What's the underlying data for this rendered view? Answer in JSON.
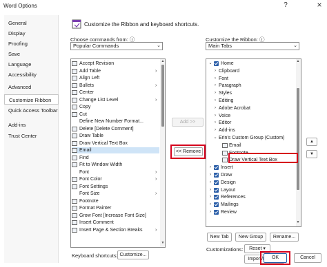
{
  "window": {
    "title": "Word Options",
    "help_glyph": "?",
    "close_glyph": "×"
  },
  "sidebar": {
    "items": [
      {
        "label": "General"
      },
      {
        "label": "Display"
      },
      {
        "label": "Proofing"
      },
      {
        "label": "Save"
      },
      {
        "label": "Language"
      },
      {
        "label": "Accessibility"
      },
      {
        "label": "Advanced"
      },
      {
        "label": "Customize Ribbon",
        "selected": true
      },
      {
        "label": "Quick Access Toolbar"
      },
      {
        "label": "Add-ins"
      },
      {
        "label": "Trust Center"
      }
    ]
  },
  "header": {
    "text": "Customize the Ribbon and keyboard shortcuts."
  },
  "left": {
    "label_pre": "",
    "label_key": "C",
    "label_post": "hoose commands from:",
    "info_glyph": "ⓘ",
    "dropdown_value": "Popular Commands",
    "commands": [
      {
        "label": "Accept Revision",
        "icon": "accept-revision-icon"
      },
      {
        "label": "Add Table",
        "icon": "table-icon",
        "submenu": true
      },
      {
        "label": "Align Left",
        "icon": "align-left-icon"
      },
      {
        "label": "Bullets",
        "icon": "bullets-icon",
        "submenu": true
      },
      {
        "label": "Center",
        "icon": "center-align-icon"
      },
      {
        "label": "Change List Level",
        "icon": "list-level-icon",
        "submenu": true
      },
      {
        "label": "Copy",
        "icon": "copy-icon"
      },
      {
        "label": "Cut",
        "icon": "cut-icon"
      },
      {
        "label": "Define New Number Format...",
        "icon": "blank-icon"
      },
      {
        "label": "Delete [Delete Comment]",
        "icon": "delete-comment-icon"
      },
      {
        "label": "Draw Table",
        "icon": "draw-table-icon"
      },
      {
        "label": "Draw Vertical Text Box",
        "icon": "vertical-text-box-icon"
      },
      {
        "label": "Email",
        "icon": "email-icon",
        "selected": true
      },
      {
        "label": "Find",
        "icon": "find-icon"
      },
      {
        "label": "Fit to Window Width",
        "icon": "fit-width-icon"
      },
      {
        "label": "Font",
        "icon": "blank-icon",
        "submenu": true
      },
      {
        "label": "Font Color",
        "icon": "font-color-icon",
        "submenu": true
      },
      {
        "label": "Font Settings",
        "icon": "font-settings-icon"
      },
      {
        "label": "Font Size",
        "icon": "blank-icon",
        "submenu": true
      },
      {
        "label": "Footnote",
        "icon": "footnote-icon"
      },
      {
        "label": "Format Painter",
        "icon": "format-painter-icon"
      },
      {
        "label": "Grow Font [Increase Font Size]",
        "icon": "grow-font-icon"
      },
      {
        "label": "Insert Comment",
        "icon": "insert-comment-icon"
      },
      {
        "label": "Insert Page & Section Breaks",
        "icon": "page-break-icon",
        "submenu": true
      }
    ]
  },
  "middle": {
    "add_label": "Add >>",
    "remove_label": "<< Remove"
  },
  "right": {
    "label_pre": "Customize the Ri",
    "label_key": "b",
    "label_post": "bon:",
    "info_glyph": "ⓘ",
    "dropdown_value": "Main Tabs",
    "tree": [
      {
        "label": "Home",
        "depth": 0,
        "expander": "⌄",
        "checked": true
      },
      {
        "label": "Clipboard",
        "depth": 1,
        "expander": "›"
      },
      {
        "label": "Font",
        "depth": 1,
        "expander": "›"
      },
      {
        "label": "Paragraph",
        "depth": 1,
        "expander": "›"
      },
      {
        "label": "Styles",
        "depth": 1,
        "expander": "›"
      },
      {
        "label": "Editing",
        "depth": 1,
        "expander": "›"
      },
      {
        "label": "Adobe Acrobat",
        "depth": 1,
        "expander": "›"
      },
      {
        "label": "Voice",
        "depth": 1,
        "expander": "›"
      },
      {
        "label": "Editor",
        "depth": 1,
        "expander": "›"
      },
      {
        "label": "Add-ins",
        "depth": 1,
        "expander": "›"
      },
      {
        "label": "Erin's Custom Group (Custom)",
        "depth": 1,
        "expander": "⌄"
      },
      {
        "label": "Email",
        "depth": 2,
        "icon": "email-icon"
      },
      {
        "label": "Footnote",
        "depth": 2,
        "icon": "footnote-icon"
      },
      {
        "label": "Draw Vertical Text Box",
        "depth": 2,
        "icon": "vertical-text-box-icon",
        "selected": true
      },
      {
        "label": "Insert",
        "depth": 0,
        "expander": "›",
        "checked": true
      },
      {
        "label": "Draw",
        "depth": 0,
        "expander": "›",
        "checked": true
      },
      {
        "label": "Design",
        "depth": 0,
        "expander": "›",
        "checked": true
      },
      {
        "label": "Layout",
        "depth": 0,
        "expander": "›",
        "checked": true
      },
      {
        "label": "References",
        "depth": 0,
        "expander": "›",
        "checked": true
      },
      {
        "label": "Mailings",
        "depth": 0,
        "expander": "›",
        "checked": true
      },
      {
        "label": "Review",
        "depth": 0,
        "expander": "›",
        "checked": true
      }
    ],
    "new_tab_label": "New Tab",
    "new_group_label": "New Group",
    "rename_label": "Rename...",
    "customizations_label": "Customizations:",
    "reset_label": "Reset ▾",
    "import_export_label": "Import/Export ▾"
  },
  "footer": {
    "keyboard_label": "Keyboard shortcuts:",
    "customize_label": "Customize...",
    "ok_label": "OK",
    "cancel_label": "Cancel"
  },
  "colors": {
    "accent_checkbox": "#2c5fa8",
    "highlight_box": "#d6001c",
    "selection_bg": "#cfe4f7"
  }
}
